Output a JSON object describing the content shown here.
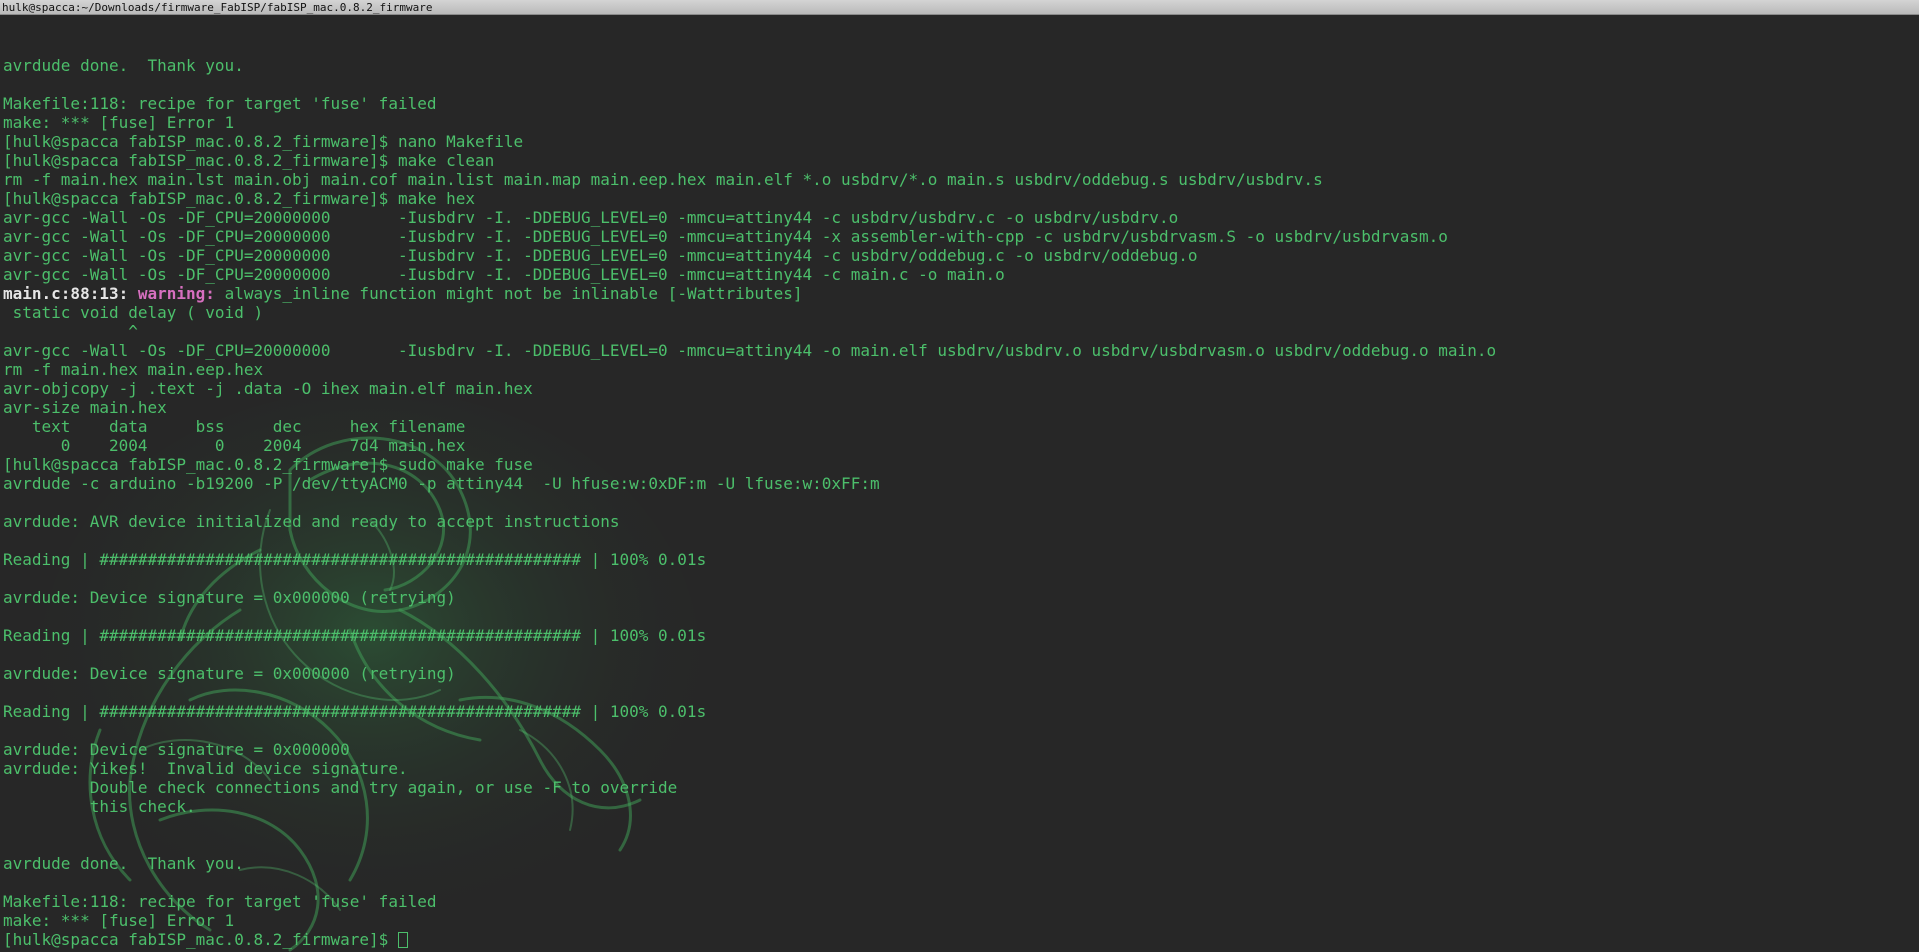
{
  "window": {
    "title": "hulk@spacca:~/Downloads/firmware_FabISP/fabISP_mac.0.8.2_firmware"
  },
  "colors": {
    "text": "#4cbf6b",
    "background": "#272727",
    "warning": "#d66fbf",
    "location": "#e6e6e6"
  },
  "terminal": {
    "lines": [
      "",
      "",
      "avrdude done.  Thank you.",
      "",
      "Makefile:118: recipe for target 'fuse' failed",
      "make: *** [fuse] Error 1",
      "[hulk@spacca fabISP_mac.0.8.2_firmware]$ nano Makefile",
      "[hulk@spacca fabISP_mac.0.8.2_firmware]$ make clean",
      "rm -f main.hex main.lst main.obj main.cof main.list main.map main.eep.hex main.elf *.o usbdrv/*.o main.s usbdrv/oddebug.s usbdrv/usbdrv.s",
      "[hulk@spacca fabISP_mac.0.8.2_firmware]$ make hex",
      "avr-gcc -Wall -Os -DF_CPU=20000000       -Iusbdrv -I. -DDEBUG_LEVEL=0 -mmcu=attiny44 -c usbdrv/usbdrv.c -o usbdrv/usbdrv.o",
      "avr-gcc -Wall -Os -DF_CPU=20000000       -Iusbdrv -I. -DDEBUG_LEVEL=0 -mmcu=attiny44 -x assembler-with-cpp -c usbdrv/usbdrvasm.S -o usbdrv/usbdrvasm.o",
      "avr-gcc -Wall -Os -DF_CPU=20000000       -Iusbdrv -I. -DDEBUG_LEVEL=0 -mmcu=attiny44 -c usbdrv/oddebug.c -o usbdrv/oddebug.o",
      "avr-gcc -Wall -Os -DF_CPU=20000000       -Iusbdrv -I. -DDEBUG_LEVEL=0 -mmcu=attiny44 -c main.c -o main.o"
    ],
    "warning_line": {
      "location": "main.c:88:13:",
      "label": "warning:",
      "message": " always_inline function might not be inlinable [-Wattributes]"
    },
    "lines_after": [
      " static void delay ( void )",
      "             ^",
      "avr-gcc -Wall -Os -DF_CPU=20000000       -Iusbdrv -I. -DDEBUG_LEVEL=0 -mmcu=attiny44 -o main.elf usbdrv/usbdrv.o usbdrv/usbdrvasm.o usbdrv/oddebug.o main.o",
      "rm -f main.hex main.eep.hex",
      "avr-objcopy -j .text -j .data -O ihex main.elf main.hex",
      "avr-size main.hex",
      "   text    data     bss     dec     hex filename",
      "      0    2004       0    2004     7d4 main.hex",
      "[hulk@spacca fabISP_mac.0.8.2_firmware]$ sudo make fuse",
      "avrdude -c arduino -b19200 -P /dev/ttyACM0 -p attiny44  -U hfuse:w:0xDF:m -U lfuse:w:0xFF:m",
      "",
      "avrdude: AVR device initialized and ready to accept instructions",
      "",
      "Reading | ################################################## | 100% 0.01s",
      "",
      "avrdude: Device signature = 0x000000 (retrying)",
      "",
      "Reading | ################################################## | 100% 0.01s",
      "",
      "avrdude: Device signature = 0x000000 (retrying)",
      "",
      "Reading | ################################################## | 100% 0.01s",
      "",
      "avrdude: Device signature = 0x000000",
      "avrdude: Yikes!  Invalid device signature.",
      "         Double check connections and try again, or use -F to override",
      "         this check.",
      "",
      "",
      "avrdude done.  Thank you.",
      "",
      "Makefile:118: recipe for target 'fuse' failed",
      "make: *** [fuse] Error 1"
    ],
    "prompt": "[hulk@spacca fabISP_mac.0.8.2_firmware]$ "
  }
}
